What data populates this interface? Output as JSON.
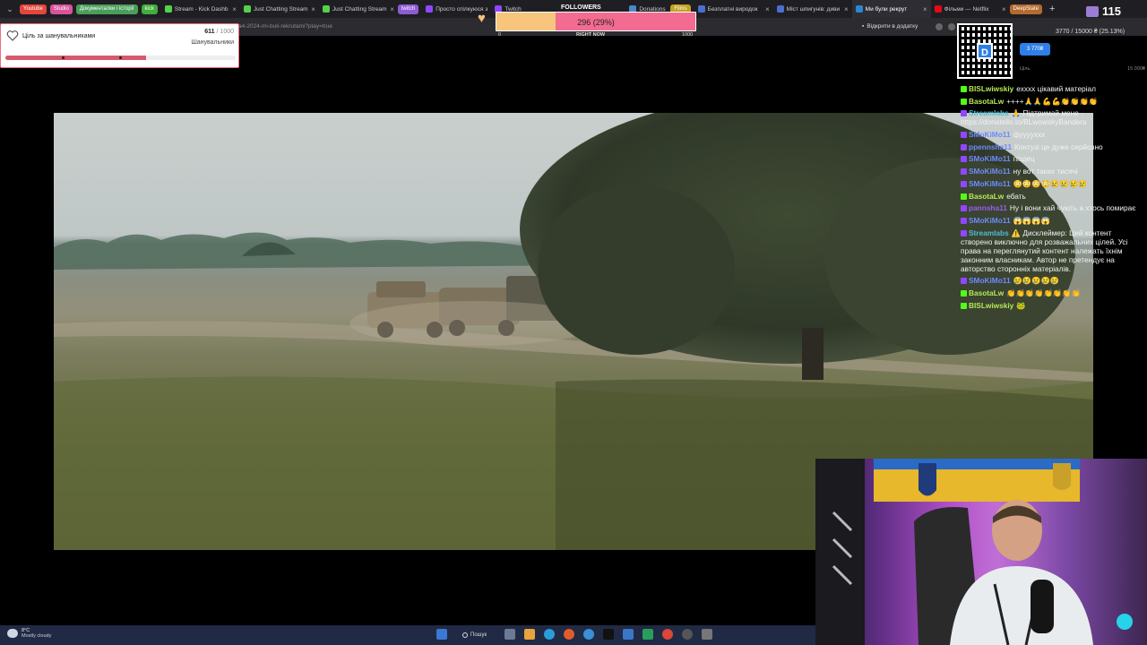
{
  "browser": {
    "tab_groups": [
      {
        "label": "Youtube",
        "color": "#e4463c"
      },
      {
        "label": "Studio",
        "color": "#d9539a"
      },
      {
        "label": "Документалки і історії",
        "color": "#4a9e5b"
      },
      {
        "label": "kick",
        "color": "#3fae3a"
      }
    ],
    "tabs": [
      {
        "title": "Stream - Kick Dashb",
        "fav": "#54d24a",
        "active": false
      },
      {
        "title": "Just Chatting Stream",
        "fav": "#54d24a",
        "active": false
      },
      {
        "title": "Just Chatting Stream",
        "fav": "#54d24a",
        "active": false
      },
      {
        "title": "Просто спілкуюся з",
        "fav": "#9146ff",
        "active": false
      },
      {
        "title": "Twitch",
        "fav": "#9146ff",
        "active": false
      },
      {
        "title": "Donations",
        "fav": "#4a88c9",
        "active": false
      },
      {
        "title": "Безплатні виродок",
        "fav": "#4a6fd0",
        "active": false
      },
      {
        "title": "Міст шпигунів: диви",
        "fav": "#4a6fd0",
        "active": false
      },
      {
        "title": "Ми були рекрут",
        "fav": "#2b87d3",
        "active": true
      },
      {
        "title": "Фільми — Netflix",
        "fav": "#e50914",
        "active": false
      }
    ],
    "tab_group_after_twitch": {
      "label": "twitch",
      "color": "#8e5bd6"
    },
    "tab_group_films": {
      "label": "Films",
      "color": "#c4a021"
    },
    "tab_group_deepstate": {
      "label": "DeepState",
      "color": "#b56a2e"
    },
    "url": "a4-2024-mi-buli-rekrutami?play=true",
    "open_in_app": "Відкрити в додатку"
  },
  "goal": {
    "title": "Ціль за шанувальниками",
    "current": "611",
    "total": "/ 1000",
    "subtitle": "Шанувальники",
    "progress": 0.61
  },
  "followers": {
    "label": "FOLLOWERS",
    "value": "296 (29%)",
    "progress": 0.296,
    "min": "0",
    "now": "RIGHT NOW",
    "max": "1000"
  },
  "viewers": "115",
  "donation": {
    "progress_text": "3770 / 15000 ₴ (25.13%)",
    "amount": "3 770₴",
    "low": "Ціль",
    "high": "15 000₴",
    "qr_letter": "D",
    "progress": 0.2513
  },
  "chat": [
    {
      "platform": "kick",
      "user": "BISLwiwskiy",
      "color": "#b5e853",
      "text": "ехххх цікавий матеріал"
    },
    {
      "platform": "kick",
      "user": "BasotaLw",
      "color": "#b5e853",
      "text": "++++🙏🙏💪💪👏👏👏👏"
    },
    {
      "platform": "twitch",
      "user": "Streamlabs",
      "color": "#4fbcd6",
      "text": "🙏 Підтримай мене - https://donatello.to/BLwowskyBandera"
    },
    {
      "platform": "twitch",
      "user": "SMoKiMo11",
      "color": "#6d8bff",
      "text": "фууууххх"
    },
    {
      "platform": "twitch",
      "user": "ppennsha11",
      "color": "#6d8bff",
      "text": "Контузі це дуже серйозно"
    },
    {
      "platform": "twitch",
      "user": "SMoKiMo11",
      "color": "#6d8bff",
      "text": "піздец"
    },
    {
      "platform": "twitch",
      "user": "SMoKiMo11",
      "color": "#6d8bff",
      "text": "ну вот таких тисячі"
    },
    {
      "platform": "twitch",
      "user": "SMoKiMo11",
      "color": "#6d8bff",
      "text": "😳😳😳😳😢😢😢😢"
    },
    {
      "platform": "kick",
      "user": "BasotaLw",
      "color": "#b5e853",
      "text": "ебать"
    },
    {
      "platform": "twitch",
      "user": "pannsha11",
      "color": "#9a5cf0",
      "text": "Ну і вони хай чують а хтось помирає"
    },
    {
      "platform": "twitch",
      "user": "SMoKiMo11",
      "color": "#6d8bff",
      "text": "😱😱😱😱"
    },
    {
      "platform": "twitch",
      "user": "Streamlabs",
      "color": "#4fbcd6",
      "text": "⚠️ Дисклеймер: Цей контент створено виключно для розважальних цілей. Усі права на переглянутий контент належать їхнім законним власникам. Автор не претендує на авторство сторонніх матеріалів."
    },
    {
      "platform": "twitch",
      "user": "SMoKiMo11",
      "color": "#6d8bff",
      "text": "😢😢😢😢😢"
    },
    {
      "platform": "kick",
      "user": "BasotaLw",
      "color": "#b5e853",
      "text": "👏👏👏👏👏👏👏👏"
    },
    {
      "platform": "kick",
      "user": "BISLwiwskiy",
      "color": "#b5e853",
      "text": "🐸"
    }
  ],
  "taskbar": {
    "weather_temp": "8°C",
    "weather_desc": "Mostly cloudy",
    "search_label": "Пошук",
    "icon_colors": [
      "#3a78d4",
      "#3a78d4",
      "#e8a33d",
      "#2a9dd9",
      "#e05c2a",
      "#3a78d4",
      "#222",
      "#3b76c8",
      "#2a9d5c",
      "#d9463a",
      "#555",
      "#777"
    ]
  }
}
